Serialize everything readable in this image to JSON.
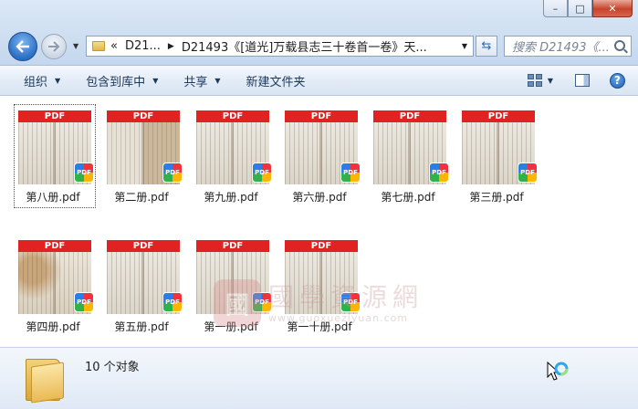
{
  "window": {
    "minimize_label": "–",
    "maximize_label": "□",
    "close_label": "✕"
  },
  "address": {
    "prefix": "«",
    "crumbs": [
      "D21...",
      "D21493《[道光]万载县志三十卷首一卷》天..."
    ]
  },
  "search": {
    "placeholder": "搜索 D21493《..."
  },
  "toolbar": {
    "organize": "组织",
    "include_in_library": "包含到库中",
    "share": "共享",
    "new_folder": "新建文件夹"
  },
  "files": [
    {
      "name": "第八册.pdf",
      "selected": true,
      "style": "plain"
    },
    {
      "name": "第二册.pdf",
      "selected": false,
      "style": "tan"
    },
    {
      "name": "第九册.pdf",
      "selected": false,
      "style": "plain"
    },
    {
      "name": "第六册.pdf",
      "selected": false,
      "style": "plain"
    },
    {
      "name": "第七册.pdf",
      "selected": false,
      "style": "plain"
    },
    {
      "name": "第三册.pdf",
      "selected": false,
      "style": "plain"
    },
    {
      "name": "第四册.pdf",
      "selected": false,
      "style": "stain"
    },
    {
      "name": "第五册.pdf",
      "selected": false,
      "style": "plain"
    },
    {
      "name": "第一册.pdf",
      "selected": false,
      "style": "half"
    },
    {
      "name": "第一十册.pdf",
      "selected": false,
      "style": "plain"
    }
  ],
  "thumb_band_text": "PDF",
  "badge_text": "PDF",
  "watermark": {
    "seal": "國",
    "title": "國學資源網",
    "url": "www.guoxueziyuan.com"
  },
  "status": {
    "count": "10 个对象"
  }
}
